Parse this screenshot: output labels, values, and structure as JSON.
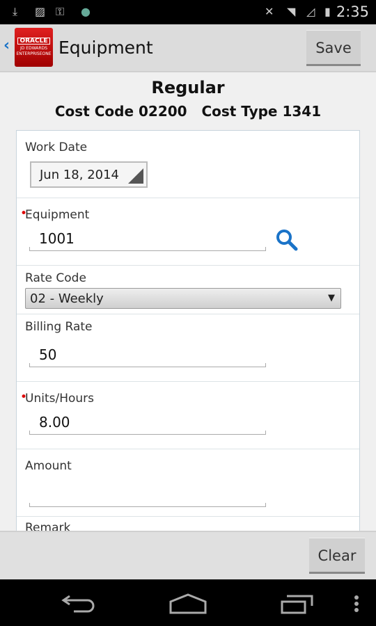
{
  "status_bar": {
    "time": "2:35",
    "icons": [
      "download-icon",
      "image-icon",
      "key-icon",
      "globe-icon",
      "mute-icon",
      "wifi-icon",
      "signal-icon",
      "battery-icon"
    ]
  },
  "header": {
    "back_icon": "chevron-left-icon",
    "logo_text": "ORACLE JD EDWARDS ENTERPRISEONE",
    "title": "Equipment",
    "save_label": "Save"
  },
  "summary": {
    "heading": "Regular",
    "cost_code": "Cost Code 02200",
    "cost_type": "Cost Type 1341"
  },
  "form": {
    "work_date": {
      "label": "Work Date",
      "value": "Jun 18, 2014"
    },
    "equipment": {
      "label": "Equipment",
      "value": "1001",
      "required": true
    },
    "rate_code": {
      "label": "Rate Code",
      "value": "02 - Weekly"
    },
    "billing_rate": {
      "label": "Billing Rate",
      "value": "50"
    },
    "units_hours": {
      "label": "Units/Hours",
      "value": "8.00",
      "required": true
    },
    "amount": {
      "label": "Amount",
      "value": ""
    },
    "remark": {
      "label": "Remark"
    }
  },
  "footer": {
    "clear_label": "Clear"
  },
  "colors": {
    "accent": "#1a73c8",
    "required": "#dd0000",
    "logo": "#c01010"
  }
}
